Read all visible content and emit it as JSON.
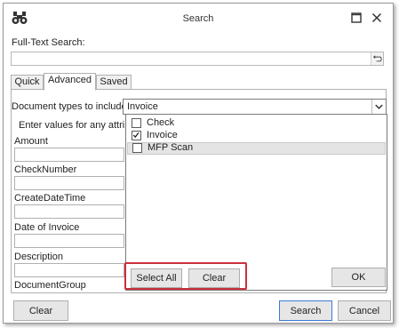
{
  "window": {
    "title": "Search"
  },
  "full_text_search": {
    "label": "Full-Text Search:",
    "value": ""
  },
  "tabs": [
    {
      "label": "Quick",
      "active": false
    },
    {
      "label": "Advanced",
      "active": true
    },
    {
      "label": "Saved",
      "active": false
    }
  ],
  "document_types": {
    "label": "Document types to include:",
    "selected_value": "Invoice"
  },
  "enter_values_label": "Enter values for any attributes",
  "attributes": [
    {
      "label": "Amount",
      "value": ""
    },
    {
      "label": "CheckNumber",
      "value": ""
    },
    {
      "label": "CreateDateTime",
      "value": ""
    },
    {
      "label": "Date of Invoice",
      "value": ""
    },
    {
      "label": "Description",
      "value": ""
    },
    {
      "label": "DocumentGroup",
      "value": ""
    }
  ],
  "popup": {
    "options": [
      {
        "label": "Check",
        "checked": false
      },
      {
        "label": "Invoice",
        "checked": true
      },
      {
        "label": "MFP Scan",
        "checked": false,
        "highlighted": true
      }
    ],
    "select_all_label": "Select All",
    "clear_label": "Clear",
    "ok_label": "OK"
  },
  "footer": {
    "clear_label": "Clear",
    "search_label": "Search",
    "cancel_label": "Cancel"
  },
  "colors": {
    "highlight_red": "#c9313a",
    "default_button_border": "#3a7bd5"
  }
}
